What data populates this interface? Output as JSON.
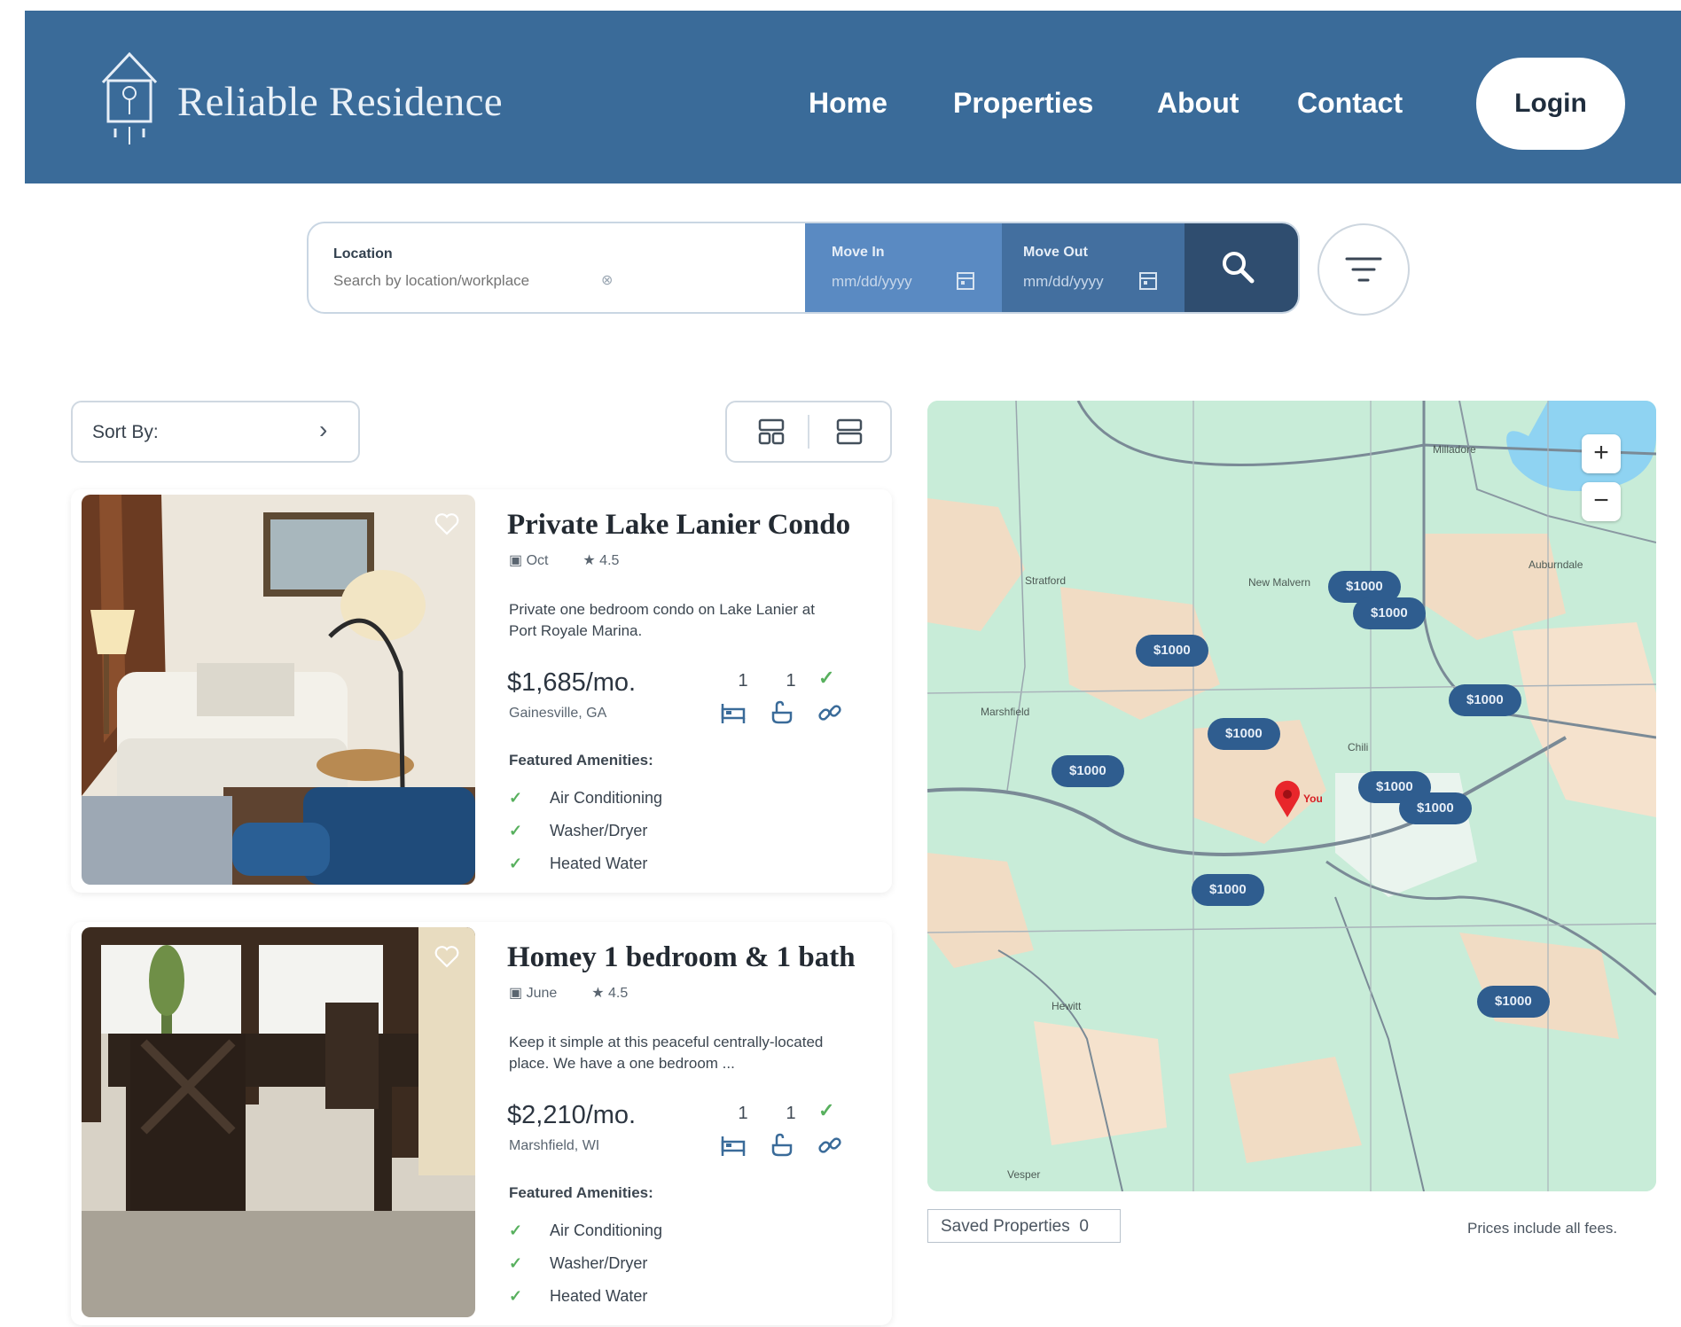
{
  "header": {
    "brand": "Reliable Residence",
    "nav": [
      "Home",
      "Properties",
      "About",
      "Contact"
    ],
    "login_label": "Login",
    "colors": {
      "header_bg": "#3a6b99",
      "accent_dark": "#2f4d6f"
    }
  },
  "search": {
    "location_label": "Location",
    "location_placeholder": "Search by location/workplace",
    "move_in_label": "Move In",
    "move_in_placeholder": "mm/dd/yyyy",
    "move_out_label": "Move Out",
    "move_out_placeholder": "mm/dd/yyyy",
    "icons": {
      "search": "search-icon",
      "filter": "filter-icon",
      "calendar": "calendar-icon"
    }
  },
  "controls": {
    "sort_label": "Sort By:",
    "views": [
      "grid-view-icon",
      "list-view-icon"
    ]
  },
  "listings": [
    {
      "title": "Private Lake Lanier Condo",
      "date": "Oct",
      "rating": "4.5",
      "description": "Private one bedroom condo on Lake Lanier at Port Royale Marina.",
      "price": "$1,685/mo.",
      "location": "Gainesville, GA",
      "beds": "1",
      "baths": "1",
      "amenities_title": "Featured Amenities:",
      "amenities": [
        "Air Conditioning",
        "Washer/Dryer",
        "Heated Water"
      ]
    },
    {
      "title": "Homey 1 bedroom & 1 bath",
      "date": "June",
      "rating": "4.5",
      "description": "Keep it simple at this peaceful centrally-located place. We have a one bedroom ...",
      "price": "$2,210/mo.",
      "location": "Marshfield, WI",
      "beds": "1",
      "baths": "1",
      "amenities_title": "Featured Amenities:",
      "amenities": [
        "Air Conditioning",
        "Washer/Dryer",
        "Heated Water"
      ]
    }
  ],
  "map": {
    "price_pins": [
      "$1000",
      "$1000",
      "$1000",
      "$1000",
      "$1000",
      "$1000",
      "$1000",
      "$1000",
      "$1000",
      "$1000"
    ],
    "towns": [
      "Stratford",
      "New Malvern",
      "Marshfield",
      "Chili",
      "Auburndale",
      "Hewitt",
      "Milladore",
      "Vesper"
    ],
    "you_label": "You",
    "zoom_in": "+",
    "zoom_out": "−",
    "colors": {
      "land": "#c8ecd8",
      "water": "#8fd3f2",
      "pin": "#2f5d8f",
      "you_pin": "#e8262b"
    }
  },
  "footer": {
    "saved_label": "Saved Properties",
    "saved_count": "0",
    "fees_note": "Prices include all fees."
  }
}
